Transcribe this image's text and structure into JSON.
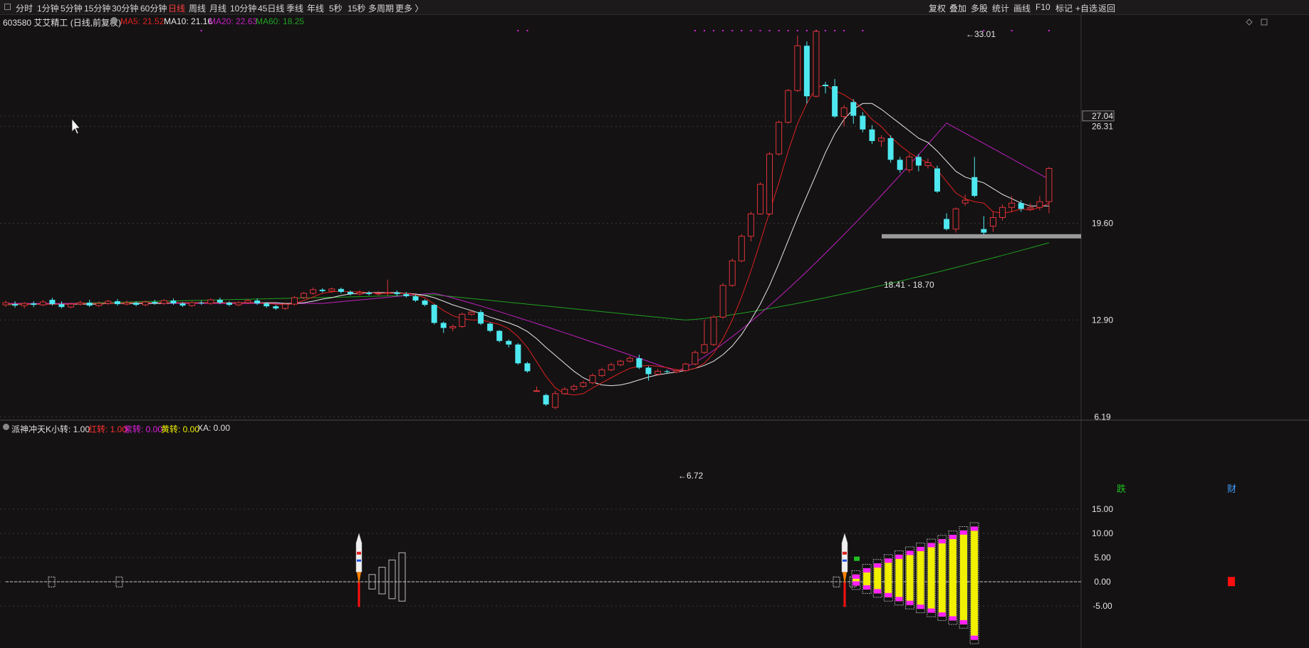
{
  "toolbar": {
    "left_items": [
      "分时",
      "1分钟",
      "5分钟",
      "15分钟",
      "30分钟",
      "60分钟",
      "日线",
      "周线",
      "月线",
      "10分钟",
      "45日线",
      "季线",
      "年线",
      "5秒",
      "15秒",
      "多周期",
      "更多 〉"
    ],
    "active_item": "日线",
    "right_items": [
      "复权",
      "叠加",
      "多股",
      "统计",
      "画线",
      "F10",
      "标记",
      "+自选",
      "返回"
    ]
  },
  "main_legend": {
    "stock": "603580 艾艾精工 (日线,前复权)",
    "ma5": "MA5: 21.52",
    "ma10": "MA10: 21.16",
    "ma20": "MA20: 22.63",
    "ma60": "MA60: 18.25"
  },
  "colors": {
    "ma5": "#e02020",
    "ma10": "#e8e8e8",
    "ma20": "#c020c0",
    "ma60": "#20a020",
    "up": "#e0343a",
    "down": "#4ee8f0",
    "marker_dots": "#e020e0",
    "yellow": "#f0f000",
    "magenta": "#ff20ff"
  },
  "price_axis": {
    "labels": [
      "27.04",
      "26.31",
      "19.60",
      "12.90",
      "6.19"
    ],
    "highlight": "27.04"
  },
  "annotations": {
    "high": "33.01",
    "low": "6.72",
    "band": "18.41 - 18.70"
  },
  "event_markers": {
    "fall": "跌",
    "finance": "财"
  },
  "indicator_legend": {
    "name": "派神冲天K",
    "small": "小转: 1.00",
    "red": "红转: 1.00",
    "purple": "紫转: 0.00",
    "yellow": "黄转: 0.00",
    "xa": "XA: 0.00"
  },
  "indicator_axis": {
    "labels": [
      "15.00",
      "10.00",
      "5.00",
      "0.00",
      "-5.00"
    ]
  },
  "chart_data": {
    "type": "candlestick",
    "ylim": [
      6.19,
      33.5
    ],
    "candles": [
      [
        13.95,
        14.1,
        14.25,
        13.8
      ],
      [
        14.0,
        13.9,
        14.2,
        13.75
      ],
      [
        13.9,
        14.05,
        14.15,
        13.7
      ],
      [
        14.05,
        13.95,
        14.2,
        13.8
      ],
      [
        13.95,
        14.15,
        14.3,
        13.85
      ],
      [
        14.3,
        14.0,
        14.45,
        13.9
      ],
      [
        14.0,
        13.8,
        14.2,
        13.7
      ],
      [
        13.8,
        14.0,
        14.1,
        13.7
      ],
      [
        14.0,
        14.1,
        14.25,
        13.9
      ],
      [
        14.1,
        13.9,
        14.3,
        13.8
      ],
      [
        13.9,
        14.05,
        14.2,
        13.8
      ],
      [
        14.05,
        14.2,
        14.3,
        13.95
      ],
      [
        14.2,
        14.0,
        14.35,
        13.9
      ],
      [
        14.0,
        14.1,
        14.25,
        13.9
      ],
      [
        14.1,
        13.95,
        14.2,
        13.85
      ],
      [
        13.95,
        14.15,
        14.25,
        13.85
      ],
      [
        14.15,
        14.05,
        14.3,
        13.95
      ],
      [
        14.05,
        14.25,
        14.35,
        13.95
      ],
      [
        14.25,
        14.05,
        14.4,
        13.95
      ],
      [
        14.05,
        13.9,
        14.15,
        13.8
      ],
      [
        13.9,
        14.1,
        14.2,
        13.8
      ],
      [
        14.1,
        14.05,
        14.25,
        13.95
      ],
      [
        14.05,
        14.3,
        14.4,
        13.95
      ],
      [
        14.3,
        14.1,
        14.45,
        14.0
      ],
      [
        14.1,
        13.95,
        14.2,
        13.85
      ],
      [
        13.95,
        14.1,
        14.2,
        13.85
      ],
      [
        14.1,
        14.25,
        14.35,
        14.0
      ],
      [
        14.25,
        14.05,
        14.4,
        13.95
      ],
      [
        14.05,
        13.85,
        14.15,
        13.75
      ],
      [
        13.85,
        13.7,
        13.95,
        13.6
      ],
      [
        13.7,
        14.0,
        14.1,
        13.6
      ],
      [
        14.0,
        14.45,
        14.55,
        13.9
      ],
      [
        14.45,
        14.75,
        14.85,
        14.35
      ],
      [
        14.75,
        15.0,
        15.15,
        14.65
      ],
      [
        15.0,
        14.9,
        15.1,
        14.8
      ],
      [
        14.9,
        15.05,
        15.15,
        14.8
      ],
      [
        15.05,
        14.85,
        15.15,
        14.75
      ],
      [
        14.85,
        14.7,
        14.95,
        14.6
      ],
      [
        14.7,
        14.8,
        14.95,
        14.6
      ],
      [
        14.8,
        14.7,
        14.9,
        14.6
      ],
      [
        14.7,
        14.75,
        14.9,
        14.6
      ],
      [
        14.75,
        14.8,
        15.7,
        14.6
      ],
      [
        14.8,
        14.7,
        14.95,
        14.55
      ],
      [
        14.7,
        14.55,
        14.85,
        14.45
      ],
      [
        14.55,
        14.25,
        14.65,
        14.15
      ],
      [
        14.25,
        13.95,
        14.35,
        13.85
      ],
      [
        13.95,
        12.7,
        14.0,
        12.6
      ],
      [
        12.7,
        12.35,
        12.8,
        12.0
      ],
      [
        12.35,
        12.45,
        12.6,
        12.1
      ],
      [
        12.45,
        13.3,
        13.4,
        12.35
      ],
      [
        13.3,
        13.45,
        13.55,
        13.2
      ],
      [
        13.45,
        12.65,
        13.6,
        12.55
      ],
      [
        12.65,
        12.15,
        12.75,
        12.05
      ],
      [
        12.15,
        11.45,
        12.2,
        11.35
      ],
      [
        11.45,
        11.2,
        11.55,
        11.0
      ],
      [
        11.2,
        9.9,
        11.3,
        9.8
      ],
      [
        9.9,
        9.35,
        10.0,
        9.25
      ],
      [
        8.0,
        8.0,
        8.3,
        7.95
      ],
      [
        7.7,
        7.05,
        7.8,
        6.95
      ],
      [
        6.85,
        7.8,
        8.0,
        6.72
      ],
      [
        7.8,
        8.1,
        8.25,
        7.7
      ],
      [
        8.1,
        8.3,
        8.45,
        7.95
      ],
      [
        8.3,
        8.55,
        8.7,
        8.2
      ],
      [
        8.55,
        9.05,
        9.2,
        8.45
      ],
      [
        9.05,
        9.45,
        9.6,
        8.95
      ],
      [
        9.45,
        9.8,
        9.95,
        9.35
      ],
      [
        9.8,
        10.05,
        10.15,
        9.7
      ],
      [
        10.05,
        10.25,
        10.4,
        9.95
      ],
      [
        10.25,
        9.6,
        10.5,
        9.5
      ],
      [
        9.6,
        9.15,
        9.7,
        8.7
      ],
      [
        9.15,
        9.35,
        9.5,
        9.05
      ],
      [
        9.35,
        9.3,
        9.45,
        9.2
      ],
      [
        9.3,
        9.4,
        9.5,
        9.2
      ],
      [
        9.4,
        9.85,
        9.95,
        9.3
      ],
      [
        9.85,
        10.65,
        10.8,
        9.75
      ],
      [
        10.65,
        11.2,
        12.9,
        10.55
      ],
      [
        11.2,
        13.1,
        13.25,
        11.1
      ],
      [
        13.1,
        15.3,
        15.45,
        13.0
      ],
      [
        15.3,
        17.0,
        17.15,
        15.2
      ],
      [
        17.0,
        18.7,
        18.85,
        16.9
      ],
      [
        18.7,
        20.25,
        20.4,
        18.35
      ],
      [
        20.25,
        22.3,
        22.45,
        20.2
      ],
      [
        20.25,
        24.4,
        24.55,
        20.15
      ],
      [
        24.4,
        26.6,
        26.7,
        24.3
      ],
      [
        26.6,
        28.8,
        28.9,
        26.5
      ],
      [
        28.8,
        31.9,
        32.6,
        28.7
      ],
      [
        31.9,
        28.4,
        32.2,
        27.9
      ],
      [
        28.4,
        32.9,
        33.01,
        28.3
      ],
      [
        29.2,
        29.1,
        29.4,
        28.6
      ],
      [
        29.1,
        27.0,
        29.6,
        26.9
      ],
      [
        27.0,
        27.6,
        27.8,
        26.3
      ],
      [
        28.0,
        27.05,
        28.2,
        26.5
      ],
      [
        27.05,
        26.1,
        27.3,
        25.9
      ],
      [
        26.1,
        25.3,
        26.4,
        25.1
      ],
      [
        25.3,
        25.5,
        25.7,
        24.9
      ],
      [
        25.5,
        24.0,
        25.7,
        23.8
      ],
      [
        24.0,
        23.3,
        24.2,
        23.1
      ],
      [
        23.3,
        24.2,
        24.4,
        23.1
      ],
      [
        24.2,
        23.6,
        24.4,
        23.2
      ],
      [
        23.6,
        23.8,
        24.1,
        23.4
      ],
      [
        23.4,
        21.8,
        23.6,
        21.7
      ],
      [
        19.9,
        19.2,
        20.3,
        19.1
      ],
      [
        19.2,
        20.6,
        20.7,
        18.95
      ],
      [
        21.0,
        21.2,
        21.6,
        20.8
      ],
      [
        22.8,
        21.5,
        24.2,
        21.4
      ],
      [
        19.2,
        18.95,
        20.1,
        18.8
      ],
      [
        19.4,
        20.0,
        20.4,
        19.0
      ],
      [
        20.0,
        20.7,
        20.9,
        19.8
      ],
      [
        20.7,
        21.0,
        21.5,
        20.4
      ],
      [
        21.0,
        20.6,
        21.2,
        20.4
      ],
      [
        20.6,
        20.7,
        21.0,
        20.5
      ],
      [
        20.7,
        21.1,
        21.5,
        20.5
      ],
      [
        21.1,
        23.4,
        23.5,
        20.3
      ]
    ],
    "ma5": [
      14.0,
      14.0,
      14.0,
      14.0,
      14.0,
      14.0,
      14.0,
      14.0,
      14.05,
      14.05,
      14.05,
      14.05,
      14.05,
      14.1,
      14.1,
      14.1,
      14.1,
      14.1,
      14.1,
      14.1,
      14.1,
      14.1,
      14.1,
      14.1,
      14.1,
      14.1,
      14.1,
      14.1,
      14.05,
      14.0,
      13.95,
      14.05,
      14.25,
      14.5,
      14.75,
      14.85,
      14.9,
      14.85,
      14.85,
      14.8,
      14.75,
      14.75,
      14.75,
      14.75,
      14.65,
      14.45,
      14.0,
      13.55,
      13.2,
      13.0,
      12.9,
      12.9,
      12.75,
      12.6,
      12.3,
      11.75,
      11.0,
      10.0,
      9.0,
      8.2,
      7.8,
      7.7,
      7.8,
      8.2,
      8.55,
      8.9,
      9.25,
      9.55,
      9.7,
      9.75,
      9.7,
      9.6,
      9.45,
      9.4,
      9.55,
      9.9,
      10.6,
      11.6,
      12.9,
      14.5,
      16.3,
      18.3,
      20.4,
      22.4,
      24.6,
      26.5,
      27.9,
      29.0,
      29.2,
      28.8,
      28.5,
      28.1,
      27.5,
      26.8,
      26.3,
      25.6,
      25.0,
      24.5,
      24.1,
      23.8,
      23.3,
      22.5,
      21.7,
      21.3,
      21.1,
      21.0,
      20.4,
      20.3,
      20.4,
      20.6,
      20.5,
      20.7,
      21.0
    ],
    "ma10": [
      14.0,
      14.0,
      14.0,
      14.0,
      14.0,
      14.0,
      14.0,
      14.0,
      14.0,
      14.0,
      14.0,
      14.05,
      14.05,
      14.05,
      14.05,
      14.05,
      14.05,
      14.05,
      14.1,
      14.1,
      14.1,
      14.1,
      14.1,
      14.1,
      14.1,
      14.1,
      14.1,
      14.1,
      14.1,
      14.1,
      14.05,
      14.05,
      14.1,
      14.2,
      14.35,
      14.45,
      14.6,
      14.7,
      14.75,
      14.8,
      14.8,
      14.8,
      14.8,
      14.75,
      14.7,
      14.6,
      14.45,
      14.2,
      13.95,
      13.75,
      13.55,
      13.35,
      13.1,
      12.9,
      12.7,
      12.45,
      12.1,
      11.6,
      11.0,
      10.45,
      9.9,
      9.35,
      8.9,
      8.6,
      8.4,
      8.35,
      8.4,
      8.55,
      8.75,
      8.95,
      9.1,
      9.2,
      9.3,
      9.4,
      9.55,
      9.75,
      10.05,
      10.5,
      11.1,
      11.9,
      12.9,
      14.0,
      15.3,
      16.8,
      18.4,
      20.0,
      21.5,
      23.0,
      24.5,
      25.8,
      26.8,
      27.5,
      27.9,
      27.9,
      27.5,
      27.0,
      26.5,
      26.0,
      25.5,
      25.2,
      24.6,
      23.9,
      23.2,
      22.8,
      22.6,
      22.4,
      22.0,
      21.6,
      21.3,
      21.0,
      20.8,
      20.8,
      20.8
    ]
  }
}
